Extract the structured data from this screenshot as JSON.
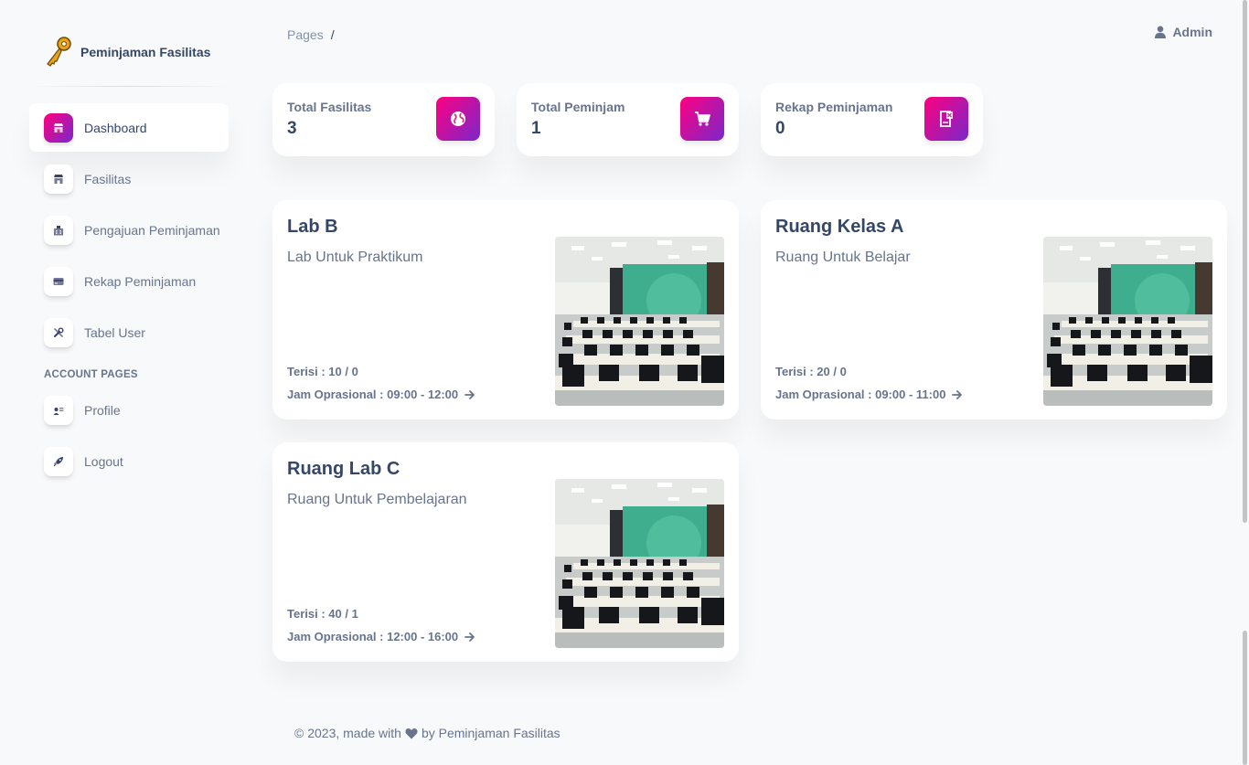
{
  "brand": {
    "name": "Peminjaman Fasilitas"
  },
  "sidebar": {
    "items": [
      {
        "label": "Dashboard",
        "icon": "shop-icon"
      },
      {
        "label": "Fasilitas",
        "icon": "shop-icon"
      },
      {
        "label": "Pengajuan Peminjaman",
        "icon": "office-icon"
      },
      {
        "label": "Rekap Peminjaman",
        "icon": "credit-card-icon"
      },
      {
        "label": "Tabel User",
        "icon": "tools-icon"
      }
    ],
    "section_label": "ACCOUNT PAGES",
    "account_items": [
      {
        "label": "Profile",
        "icon": "user-card-icon"
      },
      {
        "label": "Logout",
        "icon": "rocket-icon"
      }
    ]
  },
  "header": {
    "breadcrumb": "Pages",
    "breadcrumb_sep": "/",
    "user": "Admin"
  },
  "stats": [
    {
      "label": "Total Fasilitas",
      "value": "3",
      "icon": "globe-icon"
    },
    {
      "label": "Total Peminjam",
      "value": "1",
      "icon": "cart-icon"
    },
    {
      "label": "Rekap Peminjaman",
      "value": "0",
      "icon": "document-icon"
    }
  ],
  "facilities": [
    {
      "name": "Lab B",
      "description": "Lab Untuk Praktikum",
      "filled": "Terisi : 10 / 0",
      "hours": "Jam Oprasional : 09:00 - 12:00"
    },
    {
      "name": "Ruang Kelas A",
      "description": "Ruang Untuk Belajar",
      "filled": "Terisi : 20 / 0",
      "hours": "Jam Oprasional : 09:00 - 11:00"
    },
    {
      "name": "Ruang Lab C",
      "description": "Ruang Untuk Pembelajaran",
      "filled": "Terisi : 40 / 1",
      "hours": "Jam Oprasional : 12:00 - 16:00"
    }
  ],
  "footer": {
    "prefix": "© 2023, made with",
    "suffix": "by Peminjaman Fasilitas"
  },
  "colors": {
    "accent_start": "#7928ca",
    "accent_end": "#ff0080",
    "heading": "#344767",
    "text": "#67748e"
  }
}
